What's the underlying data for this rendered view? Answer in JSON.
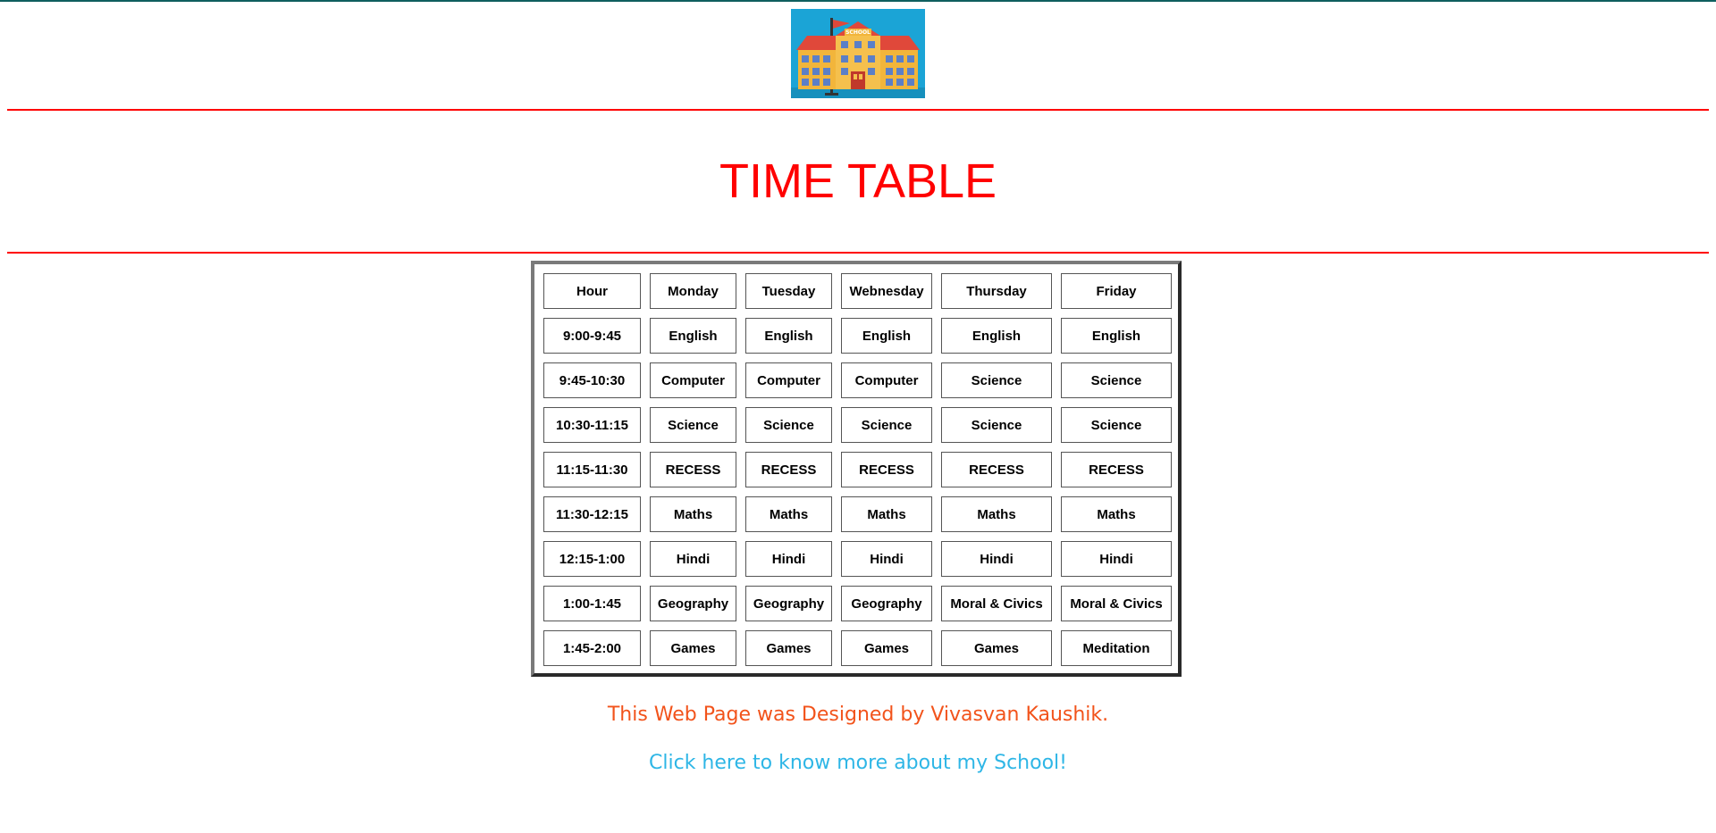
{
  "page": {
    "title": "TIME TABLE",
    "credit": "This Web Page was Designed by Vivasvan Kaushik.",
    "link_text": "Click here to know more about my School!",
    "logo_label": "SCHOOL"
  },
  "colors": {
    "title": "#ff0000",
    "rule": "#ff0000",
    "credit": "#f2531b",
    "link": "#2eb6e6",
    "logo_sky": "#1ba4d6",
    "logo_building": "#f2b53b",
    "logo_roof": "#e0483a"
  },
  "timetable": {
    "headers": [
      "Hour",
      "Monday",
      "Tuesday",
      "Webnesday",
      "Thursday",
      "Friday"
    ],
    "rows": [
      [
        "9:00-9:45",
        "English",
        "English",
        "English",
        "English",
        "English"
      ],
      [
        "9:45-10:30",
        "Computer",
        "Computer",
        "Computer",
        "Science",
        "Science"
      ],
      [
        "10:30-11:15",
        "Science",
        "Science",
        "Science",
        "Science",
        "Science"
      ],
      [
        "11:15-11:30",
        "RECESS",
        "RECESS",
        "RECESS",
        "RECESS",
        "RECESS"
      ],
      [
        "11:30-12:15",
        "Maths",
        "Maths",
        "Maths",
        "Maths",
        "Maths"
      ],
      [
        "12:15-1:00",
        "Hindi",
        "Hindi",
        "Hindi",
        "Hindi",
        "Hindi"
      ],
      [
        "1:00-1:45",
        "Geography",
        "Geography",
        "Geography",
        "Moral & Civics",
        "Moral & Civics"
      ],
      [
        "1:45-2:00",
        "Games",
        "Games",
        "Games",
        "Games",
        "Meditation"
      ]
    ]
  }
}
